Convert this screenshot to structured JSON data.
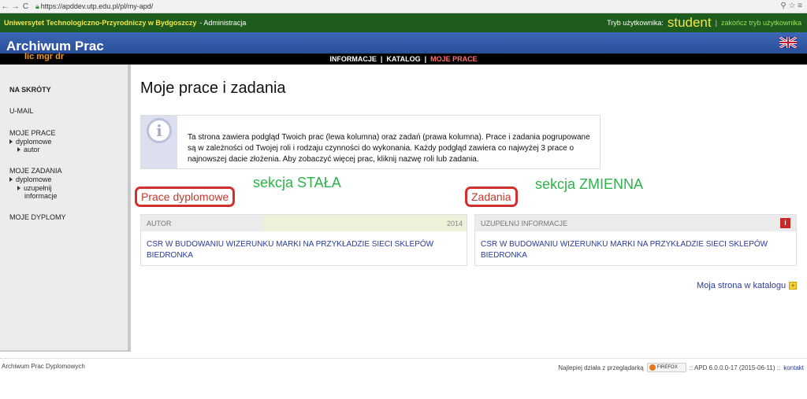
{
  "browser": {
    "url": "https://apddev.utp.edu.pl/pl/my-apd/",
    "back_label": "←",
    "forward_label": "→",
    "reload_label": "C"
  },
  "topbar": {
    "university": "Uniwersytet Technologiczno-Przyrodniczy w Bydgoszczy",
    "section": "- Administracja",
    "mode_label": "Tryb użytkownika:",
    "mode_value": "student",
    "separator": "|",
    "end_mode": "zakończ tryb użytkownika"
  },
  "header": {
    "app_title": "Archiwum Prac",
    "subtitle": "lic mgr dr"
  },
  "menu": {
    "items": [
      "INFORMACJE",
      "KATALOG",
      "MOJE PRACE"
    ],
    "separator": "|"
  },
  "sidebar": {
    "shortcuts": "NA SKRÓTY",
    "umail": "U-MAIL",
    "my_works": "MOJE PRACE",
    "my_works_sub1": "dyplomowe",
    "my_works_sub2": "autor",
    "my_tasks": "MOJE ZADANIA",
    "my_tasks_sub1": "dyplomowe",
    "my_tasks_sub2a": "uzupełnij",
    "my_tasks_sub2b": "informacje",
    "my_diplomas": "MOJE DYPLOMY"
  },
  "main": {
    "title": "Moje prace i zadania",
    "info_text": "Ta strona zawiera podgląd Twoich prac (lewa kolumna) oraz zadań (prawa kolumna). Prace i zadania pogrupowane są w zależności od Twojej roli i rodzaju czynności do wykonania. Każdy podgląd zawiera co najwyżej 3 prace o najnowszej dacie złożenia. Aby zobaczyć więcej prac, kliknij nazwę roli lub zadania.",
    "annot_fixed": "sekcja STAŁA",
    "annot_variable": "sekcja ZMIENNA",
    "left_section": "Prace dyplomowe",
    "right_section": "Zadania",
    "left_panel": {
      "header": "AUTOR",
      "year": "2014",
      "title": "CSR W BUDOWANIU WIZERUNKU MARKI NA PRZYKŁADZIE SIECI SKLEPÓW BIEDRONKA"
    },
    "right_panel": {
      "header": "UZUPEŁNIJ INFORMACJE",
      "badge": "i",
      "title": "CSR W BUDOWANIU WIZERUNKU MARKI NA PRZYKŁADZIE SIECI SKLEPÓW BIEDRONKA"
    },
    "catalog_link": "Moja strona w katalogu",
    "catalog_plus": "+"
  },
  "footer": {
    "left": "Archiwum Prac Dyplomowych",
    "works_best": "Najlepiej działa z przeglądarką",
    "badge": "FIREFOX",
    "version": ":: APD 6.0.0.0-17 (2015-06-11) ::",
    "contact": "kontakt"
  },
  "colors": {
    "topbar": "#1d5c1c",
    "header": "#2a4f99",
    "accent_yellow": "#f3e64a",
    "annotation": "#2cb34a",
    "annotation_box": "#d32f2f"
  }
}
